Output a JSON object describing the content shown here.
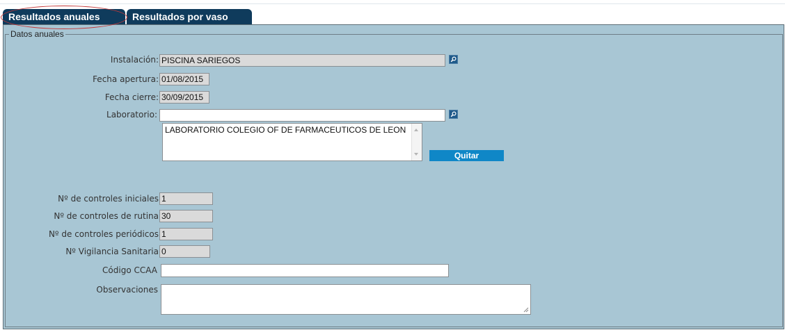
{
  "tabs": [
    {
      "label": "Resultados anuales",
      "active": true
    },
    {
      "label": "Resultados por vaso",
      "active": false
    }
  ],
  "section": {
    "legend": "Datos anuales"
  },
  "form": {
    "instalacion": {
      "label": "Instalación:",
      "value": "PISCINA SARIEGOS"
    },
    "fecha_apertura": {
      "label": "Fecha apertura:",
      "value": "01/08/2015"
    },
    "fecha_cierre": {
      "label": "Fecha cierre:",
      "value": "30/09/2015"
    },
    "laboratorio": {
      "label": "Laboratorio:",
      "value": "",
      "list_items": [
        "LABORATORIO COLEGIO OF DE FARMACEUTICOS DE LEON"
      ],
      "remove_label": "Quitar"
    },
    "controles_iniciales": {
      "label": "Nº de controles iniciales",
      "value": "1"
    },
    "controles_rutina": {
      "label": "Nº de controles de rutina",
      "value": "30"
    },
    "controles_periodicos": {
      "label": "Nº de controles periódicos",
      "value": "1"
    },
    "vigilancia_sanitaria": {
      "label": "Nº Vigilancia Sanitaria",
      "value": "0"
    },
    "codigo_ccaa": {
      "label": "Código CCAA",
      "value": ""
    },
    "observaciones": {
      "label": "Observaciones",
      "value": ""
    }
  },
  "icons": {
    "search": "magnifier-icon"
  },
  "colors": {
    "tab_bg": "#0f3b5c",
    "panel_bg": "#a8c6d4",
    "button_bg": "#0f87c7",
    "readonly_bg": "#dadada",
    "highlight": "#c43a3a"
  }
}
